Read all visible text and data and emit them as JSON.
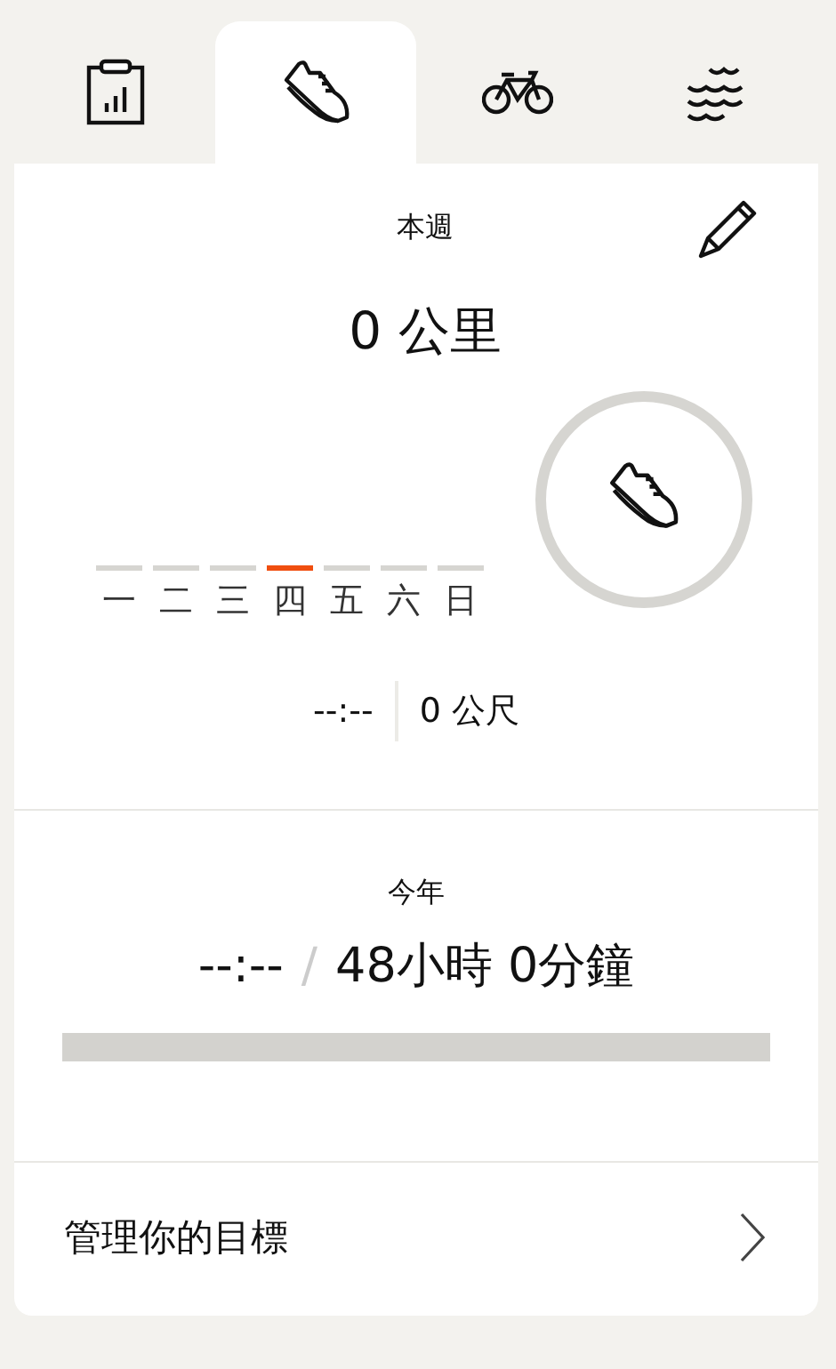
{
  "tabs": [
    {
      "kind": "stats",
      "selected": false
    },
    {
      "kind": "run",
      "selected": true
    },
    {
      "kind": "bike",
      "selected": false
    },
    {
      "kind": "swim",
      "selected": false
    }
  ],
  "week": {
    "title": "本週",
    "distance": "0 公里",
    "days": [
      {
        "label": "一",
        "selected": false
      },
      {
        "label": "二",
        "selected": false
      },
      {
        "label": "三",
        "selected": false
      },
      {
        "label": "四",
        "selected": true
      },
      {
        "label": "五",
        "selected": false
      },
      {
        "label": "六",
        "selected": false
      },
      {
        "label": "日",
        "selected": false
      }
    ],
    "time": "--:--",
    "meters": "0 公尺"
  },
  "year": {
    "title": "今年",
    "done": "--:--",
    "separator": "/",
    "goal": "48小時 0分鐘",
    "level": 0
  },
  "manage_link": "管理你的目標"
}
